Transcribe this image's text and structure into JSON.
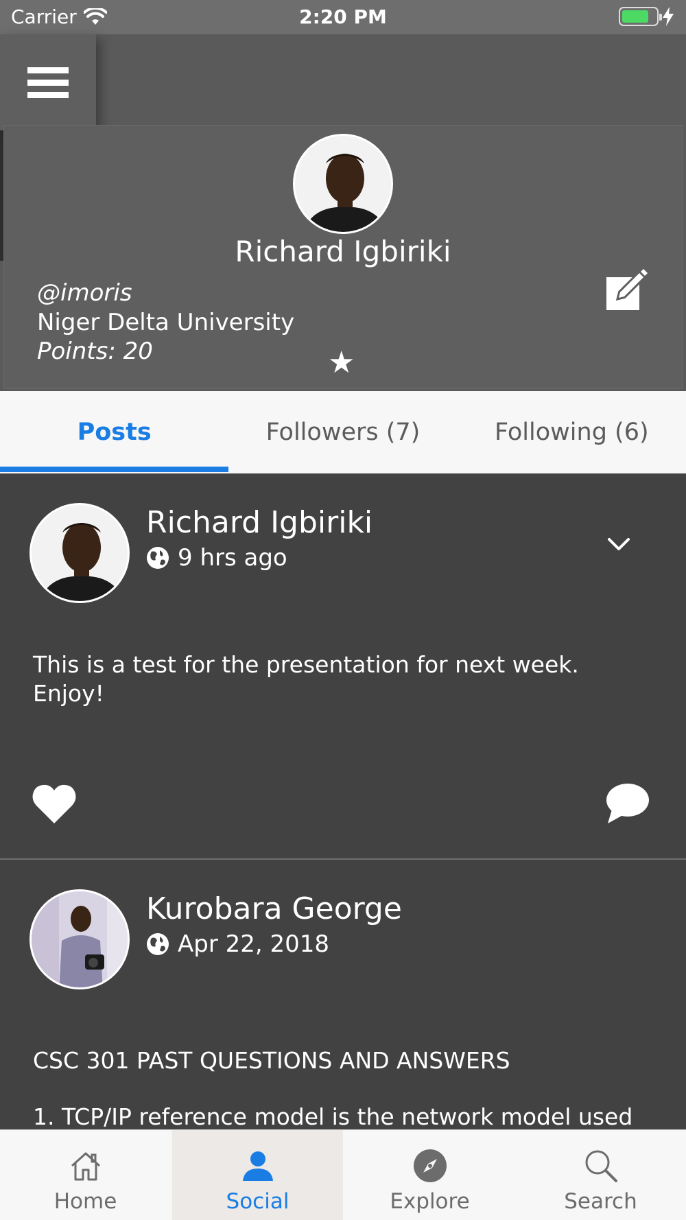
{
  "status_bar": {
    "carrier": "Carrier",
    "time": "2:20 PM"
  },
  "profile": {
    "name": "Richard Igbiriki",
    "handle": "@imoris",
    "school": "Niger Delta University",
    "points": "Points: 20",
    "star": "★"
  },
  "tabs": [
    {
      "label": "Posts",
      "active": true
    },
    {
      "label": "Followers (7)",
      "active": false
    },
    {
      "label": "Following (6)",
      "active": false
    }
  ],
  "posts": [
    {
      "author": "Richard Igbiriki",
      "time": "9 hrs ago",
      "body": "This is a test for the presentation for next week.\nEnjoy!"
    },
    {
      "author": "Kurobara George",
      "time": "Apr 22, 2018",
      "body": "CSC 301 PAST QUESTIONS AND ANSWERS",
      "body2": "1. TCP/IP reference model is the network model used"
    }
  ],
  "tabbar": [
    {
      "label": "Home",
      "icon": "home-icon"
    },
    {
      "label": "Social",
      "icon": "person-icon",
      "active": true
    },
    {
      "label": "Explore",
      "icon": "compass-icon"
    },
    {
      "label": "Search",
      "icon": "search-icon"
    }
  ],
  "colors": {
    "accent": "#1a7de3",
    "battery": "#4cd964",
    "card": "#5f5f5f",
    "feed": "#424242"
  }
}
